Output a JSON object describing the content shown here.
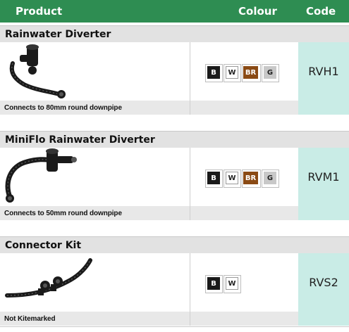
{
  "header": {
    "product": "Product",
    "colour": "Colour",
    "code": "Code"
  },
  "products": [
    {
      "name": "Rainwater Diverter",
      "code": "RVH1",
      "note": "Connects to 80mm round downpipe",
      "swatches": [
        "B",
        "W",
        "BR",
        "G"
      ]
    },
    {
      "name": "MiniFlo Rainwater Diverter",
      "code": "RVM1",
      "note": "Connects to 50mm round downpipe",
      "swatches": [
        "B",
        "W",
        "BR",
        "G"
      ]
    },
    {
      "name": "Connector Kit",
      "code": "RVS2",
      "note": "Not Kitemarked",
      "swatches": [
        "B",
        "W"
      ]
    }
  ],
  "colors": {
    "header_green": "#2e8d52",
    "code_cell": "#c9ece6",
    "black": "#1a1a1a",
    "brown": "#8a4a14",
    "grey": "#c8c8c8"
  }
}
